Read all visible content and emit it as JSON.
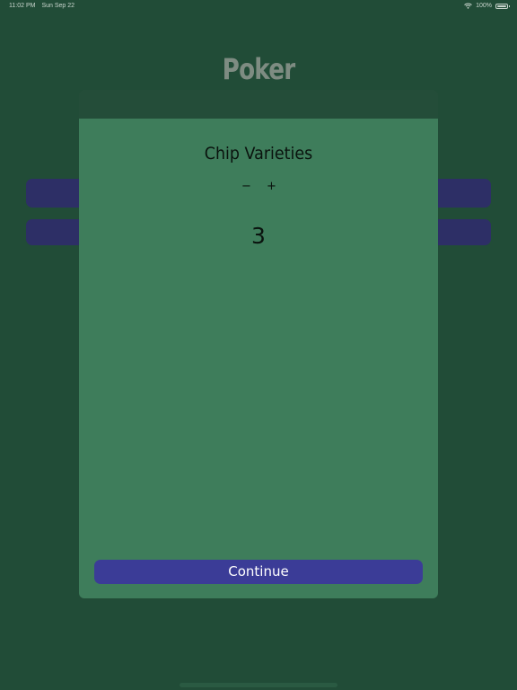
{
  "status_bar": {
    "time": "11:02 PM",
    "date": "Sun Sep 22",
    "battery": "100%",
    "wifi_icon": "wifi-icon",
    "battery_icon": "battery-icon"
  },
  "app": {
    "title": "Poker"
  },
  "modal": {
    "title": "Chip Varieties",
    "decrement_label": "−",
    "increment_label": "+",
    "value": "3",
    "continue_label": "Continue"
  },
  "colors": {
    "background": "#214c37",
    "modal": "#3e7d5b",
    "button": "#3b3c97",
    "dimmed_button": "#2d2f66"
  }
}
